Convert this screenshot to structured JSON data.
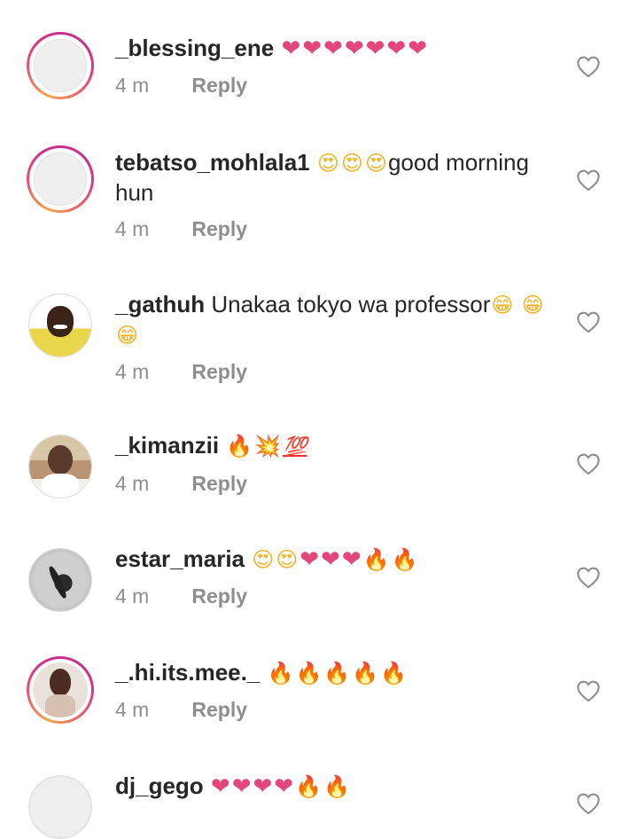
{
  "comments": [
    {
      "username": "_blessing_ene",
      "text": "",
      "emojis": [
        "❤",
        "❤",
        "❤",
        "❤",
        "❤",
        "❤",
        "❤"
      ],
      "time": "4 m",
      "reply_label": "Reply",
      "avatar": "blank-ring"
    },
    {
      "username": "tebatso_mohlala1",
      "emojis_prefix": [
        "😍",
        "😍",
        "😍"
      ],
      "text": "good morning hun",
      "time": "4 m",
      "reply_label": "Reply",
      "avatar": "blank-ring"
    },
    {
      "username": "_gathuh",
      "text": "Unakaa tokyo wa professor",
      "emojis": [
        "😁",
        "😁",
        "😁"
      ],
      "time": "4 m",
      "reply_label": "Reply",
      "avatar": "photo"
    },
    {
      "username": "_kimanzii",
      "text": "",
      "emojis": [
        "🔥",
        "💥",
        "💯"
      ],
      "time": "4 m",
      "reply_label": "Reply",
      "avatar": "photo"
    },
    {
      "username": "estar_maria",
      "text": "",
      "emojis": [
        "😍",
        "😍",
        "❤",
        "❤",
        "❤",
        "🔥",
        "🔥"
      ],
      "time": "4 m",
      "reply_label": "Reply",
      "avatar": "photo"
    },
    {
      "username": "_.hi.its.mee._",
      "text": "",
      "emojis": [
        "🔥",
        "🔥",
        "🔥",
        "🔥",
        "🔥"
      ],
      "time": "4 m",
      "reply_label": "Reply",
      "avatar": "photo-ring"
    },
    {
      "username": "dj_gego",
      "text": "",
      "emojis": [
        "❤",
        "❤",
        "❤",
        "❤",
        "🔥",
        "🔥"
      ],
      "time": "",
      "reply_label": "",
      "avatar": "blank"
    }
  ],
  "colors": {
    "text": "#262626",
    "meta": "#8e8e8e",
    "heart": "#e2467a",
    "ring_start": "#f7a34a",
    "ring_end": "#c2318b"
  },
  "icons": {
    "like": "heart-outline-icon"
  }
}
